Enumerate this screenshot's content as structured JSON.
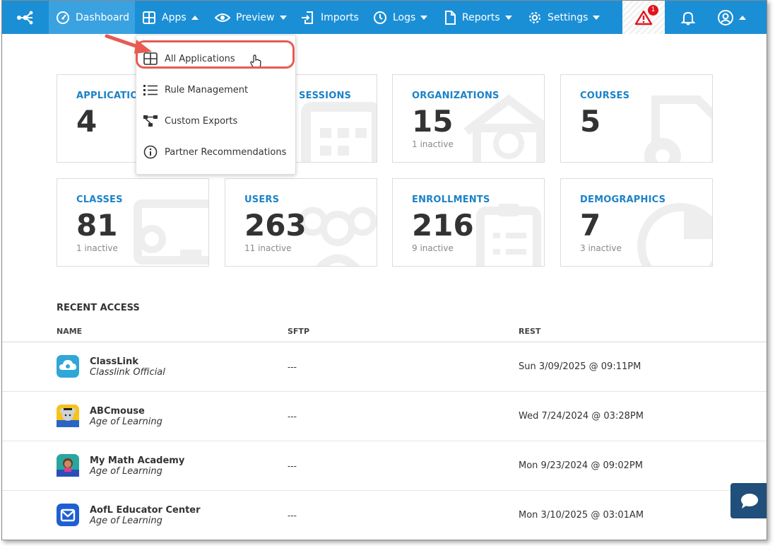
{
  "nav": {
    "items": [
      {
        "label": "Dashboard"
      },
      {
        "label": "Apps"
      },
      {
        "label": "Preview"
      },
      {
        "label": "Imports"
      },
      {
        "label": "Logs"
      },
      {
        "label": "Reports"
      },
      {
        "label": "Settings"
      }
    ],
    "alert_count": "1"
  },
  "apps_menu": {
    "items": [
      {
        "label": "All Applications",
        "icon": "grid-icon"
      },
      {
        "label": "Rule Management",
        "icon": "list-icon"
      },
      {
        "label": "Custom Exports",
        "icon": "flow-icon"
      },
      {
        "label": "Partner Recommendations",
        "icon": "info-icon"
      }
    ],
    "highlighted": "All Applications"
  },
  "stats": [
    {
      "title": "APPLICATIONS",
      "value": "4",
      "sub": ""
    },
    {
      "title": "SESSIONS",
      "value": "",
      "sub": ""
    },
    {
      "title": "ORGANIZATIONS",
      "value": "15",
      "sub": "1 inactive"
    },
    {
      "title": "COURSES",
      "value": "5",
      "sub": ""
    },
    {
      "title": "CLASSES",
      "value": "81",
      "sub": "1 inactive"
    },
    {
      "title": "USERS",
      "value": "263",
      "sub": "11 inactive"
    },
    {
      "title": "ENROLLMENTS",
      "value": "216",
      "sub": "9 inactive"
    },
    {
      "title": "DEMOGRAPHICS",
      "value": "7",
      "sub": "3 inactive"
    }
  ],
  "recent": {
    "title": "RECENT ACCESS",
    "columns": [
      "NAME",
      "SFTP",
      "REST"
    ],
    "rows": [
      {
        "name": "ClassLink",
        "vendor": "Classlink Official",
        "sftp": "---",
        "rest": "Sun 3/09/2025 @ 09:11PM"
      },
      {
        "name": "ABCmouse",
        "vendor": "Age of Learning",
        "sftp": "---",
        "rest": "Wed 7/24/2024 @ 03:28PM"
      },
      {
        "name": "My Math Academy",
        "vendor": "Age of Learning",
        "sftp": "---",
        "rest": "Mon 9/23/2024 @ 09:02PM"
      },
      {
        "name": "AofL Educator Center",
        "vendor": "Age of Learning",
        "sftp": "---",
        "rest": "Mon 3/10/2025 @ 03:01AM"
      }
    ]
  },
  "colors": {
    "nav": "#1b8fd6",
    "nav_active": "#3aa2e0",
    "title_blue": "#1b82c8",
    "highlight": "#e85a52",
    "chat": "#1f4f7a"
  }
}
